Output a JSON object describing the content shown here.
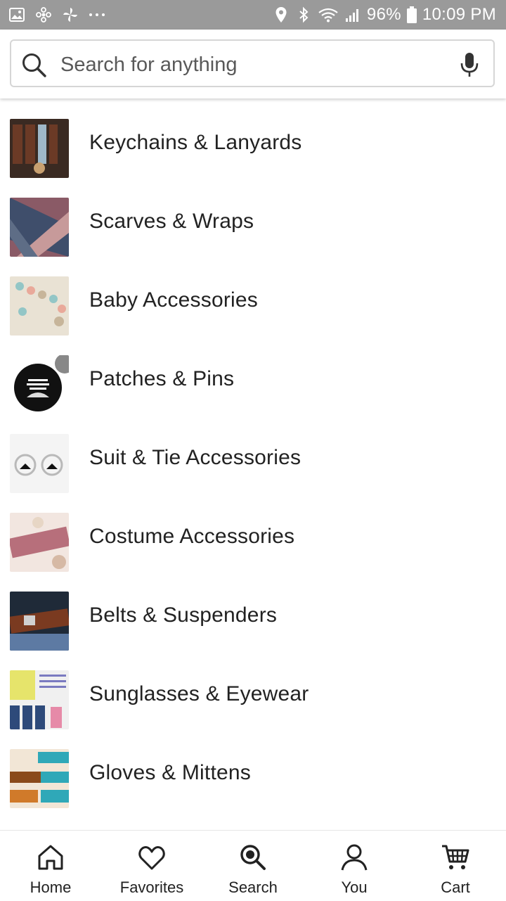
{
  "status_bar": {
    "battery": "96%",
    "time": "10:09 PM",
    "left_icons": [
      "gallery-icon",
      "pinwheel-icon",
      "fan-icon",
      "more-dots-icon"
    ],
    "right_icons": [
      "location-icon",
      "bluetooth-icon",
      "wifi-icon",
      "signal-icon",
      "battery-icon"
    ]
  },
  "search": {
    "placeholder": "Search for anything",
    "value": ""
  },
  "categories": [
    {
      "label": "Keychains & Lanyards",
      "thumb_colors": [
        "#6b3a26",
        "#3a2a22",
        "#9fb8c8",
        "#c8a070"
      ]
    },
    {
      "label": "Scarves & Wraps",
      "thumb_colors": [
        "#8a5a66",
        "#3f4e6b",
        "#c79a9a",
        "#5e6d86"
      ]
    },
    {
      "label": "Baby Accessories",
      "thumb_colors": [
        "#e9e2d4",
        "#c7b59a",
        "#93c6c6",
        "#e9a99a"
      ]
    },
    {
      "label": "Patches & Pins",
      "thumb_colors": [
        "#111111",
        "#dcdcdc",
        "#444444",
        "#888888"
      ]
    },
    {
      "label": "Suit & Tie Accessories",
      "thumb_colors": [
        "#f4f4f4",
        "#e2e2e2",
        "#111111",
        "#b9b9b9"
      ]
    },
    {
      "label": "Costume Accessories",
      "thumb_colors": [
        "#f2e6e0",
        "#b76f7b",
        "#e7d6c5",
        "#d6b9a5"
      ]
    },
    {
      "label": "Belts & Suspenders",
      "thumb_colors": [
        "#1f2a38",
        "#7a3a20",
        "#5d7aa3",
        "#b05a2a"
      ]
    },
    {
      "label": "Sunglasses & Eyewear",
      "thumb_colors": [
        "#e6e46b",
        "#2e4a7a",
        "#f0f0f0",
        "#e68aa8"
      ]
    },
    {
      "label": "Gloves & Mittens",
      "thumb_colors": [
        "#f2e6d6",
        "#2fa8b8",
        "#d07a2a",
        "#8a4a1a"
      ]
    }
  ],
  "bottom_nav": [
    {
      "label": "Home",
      "icon": "home-icon"
    },
    {
      "label": "Favorites",
      "icon": "heart-icon"
    },
    {
      "label": "Search",
      "icon": "search-icon"
    },
    {
      "label": "You",
      "icon": "person-icon"
    },
    {
      "label": "Cart",
      "icon": "cart-icon"
    }
  ]
}
